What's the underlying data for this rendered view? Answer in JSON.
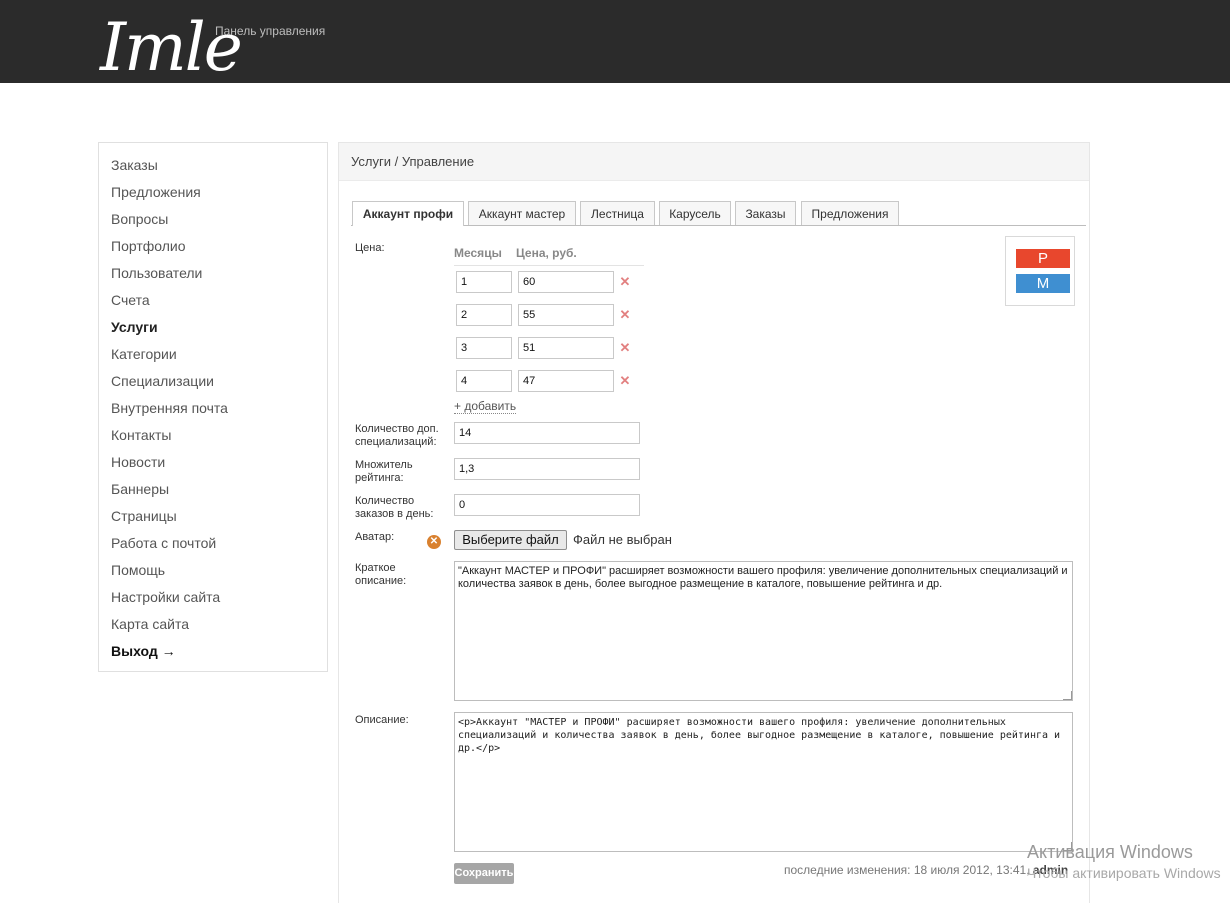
{
  "header": {
    "logo_text": "Imle",
    "panel_title": "Панель управления"
  },
  "sidebar": {
    "items": [
      {
        "label": "Заказы"
      },
      {
        "label": "Предложения"
      },
      {
        "label": "Вопросы"
      },
      {
        "label": "Портфолио"
      },
      {
        "label": "Пользователи"
      },
      {
        "label": "Счета"
      },
      {
        "label": "Услуги",
        "active": true
      },
      {
        "label": "Категории"
      },
      {
        "label": "Специализации"
      },
      {
        "label": "Внутренняя почта"
      },
      {
        "label": "Контакты"
      },
      {
        "label": "Новости"
      },
      {
        "label": "Баннеры"
      },
      {
        "label": "Страницы"
      },
      {
        "label": "Работа с почтой"
      },
      {
        "label": "Помощь"
      },
      {
        "label": "Настройки сайта"
      },
      {
        "label": "Карта сайта"
      },
      {
        "label": "Выход →"
      }
    ]
  },
  "main": {
    "breadcrumb": "Услуги / Управление",
    "tabs": [
      {
        "label": "Аккаунт профи",
        "active": true
      },
      {
        "label": "Аккаунт мастер"
      },
      {
        "label": "Лестница"
      },
      {
        "label": "Карусель"
      },
      {
        "label": "Заказы"
      },
      {
        "label": "Предложения"
      }
    ],
    "badge": {
      "top": "P",
      "bottom": "M",
      "top_color": "#e8472d",
      "bottom_color": "#3f8fd1"
    },
    "form": {
      "price_label": "Цена:",
      "col_months": "Месяцы",
      "col_price": "Цена, руб.",
      "price_rows": [
        {
          "months": "1",
          "price": "60"
        },
        {
          "months": "2",
          "price": "55"
        },
        {
          "months": "3",
          "price": "51"
        },
        {
          "months": "4",
          "price": "47"
        }
      ],
      "add_link": "+ добавить",
      "extra_spec_label": "Количество доп. специализаций:",
      "extra_spec_value": "14",
      "rating_label": "Множитель рейтинга:",
      "rating_value": "1,3",
      "orders_label": "Количество заказов в день:",
      "orders_value": "0",
      "avatar_label": "Аватар:",
      "file_button": "Выберите файл",
      "file_status": "Файл не выбран",
      "short_desc_label": "Краткое описание:",
      "short_desc_value": "\"Аккаунт МАСТЕР и ПРОФИ\" расширяет возможности вашего профиля: увеличение дополнительных специализаций и количества заявок в день, более выгодное размещение в каталоге, повышение рейтинга и др.",
      "desc_label": "Описание:",
      "desc_value": "<p>Аккаунт \"МАСТЕР и ПРОФИ\" расширяет возможности вашего профиля: увеличение дополнительных специализаций и количества заявок в день, более выгодное размещение в каталоге, повышение рейтинга и др.</p>",
      "save_button": "Сохранить",
      "last_change_prefix": "последние изменения: 18 июля 2012, 13:41,",
      "last_change_user": "admin"
    }
  },
  "watermark": {
    "line1": "Активация Windows",
    "line2": "Чтобы активировать Windows"
  }
}
